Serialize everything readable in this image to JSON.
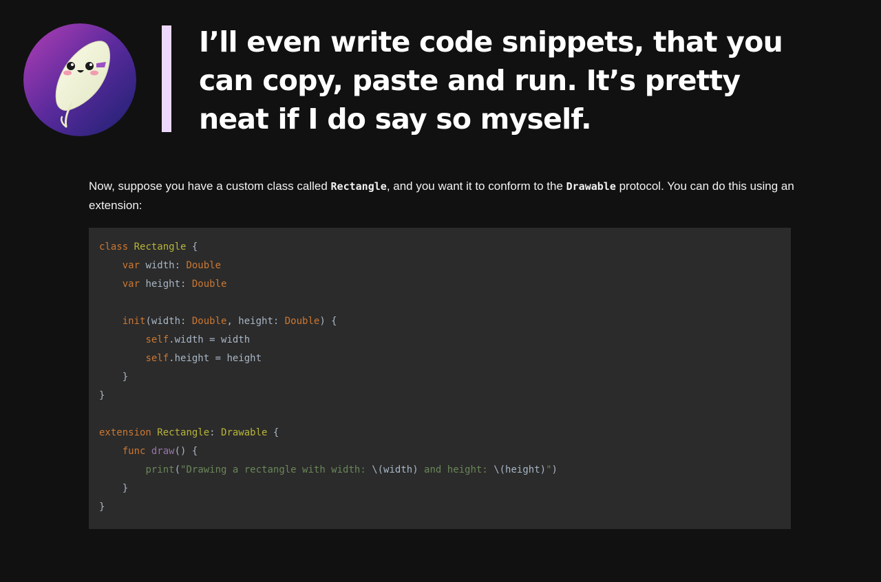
{
  "colors": {
    "background": "#111111",
    "quote_accent": "#ecd7ff",
    "code_background": "#2b2b2b",
    "keyword": "#cc7832",
    "type_name": "#b8b53a",
    "function_name": "#9876aa",
    "string": "#6a8759",
    "identifier": "#a9b7c6"
  },
  "avatar": {
    "icon": "feather-mascot-icon"
  },
  "headline": {
    "lines": [
      "I’ll even write code snippets, that you",
      "can copy, paste and run. It’s pretty",
      "neat if I do say so myself."
    ]
  },
  "intro": {
    "part1": "Now, suppose you have a custom class called ",
    "code1": "Rectangle",
    "part2": ", and you want it to conform to the ",
    "code2": "Drawable",
    "part3": " protocol. You can do this using an extension:"
  },
  "code": {
    "language": "swift",
    "lines": [
      [
        {
          "t": "kw",
          "v": "class"
        },
        {
          "t": "id",
          "v": " "
        },
        {
          "t": "cls",
          "v": "Rectangle"
        },
        {
          "t": "id",
          "v": " {"
        }
      ],
      [
        {
          "t": "id",
          "v": "    "
        },
        {
          "t": "kw",
          "v": "var"
        },
        {
          "t": "id",
          "v": " width: "
        },
        {
          "t": "kw",
          "v": "Double"
        }
      ],
      [
        {
          "t": "id",
          "v": "    "
        },
        {
          "t": "kw",
          "v": "var"
        },
        {
          "t": "id",
          "v": " height: "
        },
        {
          "t": "kw",
          "v": "Double"
        }
      ],
      [],
      [
        {
          "t": "id",
          "v": "    "
        },
        {
          "t": "kw",
          "v": "init"
        },
        {
          "t": "id",
          "v": "(width: "
        },
        {
          "t": "kw",
          "v": "Double"
        },
        {
          "t": "id",
          "v": ", height: "
        },
        {
          "t": "kw",
          "v": "Double"
        },
        {
          "t": "id",
          "v": ") {"
        }
      ],
      [
        {
          "t": "id",
          "v": "        "
        },
        {
          "t": "kw",
          "v": "self"
        },
        {
          "t": "id",
          "v": ".width = width"
        }
      ],
      [
        {
          "t": "id",
          "v": "        "
        },
        {
          "t": "kw",
          "v": "self"
        },
        {
          "t": "id",
          "v": ".height = height"
        }
      ],
      [
        {
          "t": "id",
          "v": "    }"
        }
      ],
      [
        {
          "t": "id",
          "v": "}"
        }
      ],
      [],
      [
        {
          "t": "kw",
          "v": "extension"
        },
        {
          "t": "id",
          "v": " "
        },
        {
          "t": "cls",
          "v": "Rectangle"
        },
        {
          "t": "id",
          "v": ": "
        },
        {
          "t": "cls",
          "v": "Drawable"
        },
        {
          "t": "id",
          "v": " {"
        }
      ],
      [
        {
          "t": "id",
          "v": "    "
        },
        {
          "t": "kw",
          "v": "func"
        },
        {
          "t": "id",
          "v": " "
        },
        {
          "t": "fn",
          "v": "draw"
        },
        {
          "t": "id",
          "v": "() {"
        }
      ],
      [
        {
          "t": "id",
          "v": "        "
        },
        {
          "t": "str",
          "v": "print"
        },
        {
          "t": "id",
          "v": "("
        },
        {
          "t": "str",
          "v": "\"Drawing a rectangle with width: "
        },
        {
          "t": "id",
          "v": "\\(width)"
        },
        {
          "t": "str",
          "v": " and height: "
        },
        {
          "t": "id",
          "v": "\\(height)"
        },
        {
          "t": "str",
          "v": "\""
        },
        {
          "t": "id",
          "v": ")"
        }
      ],
      [
        {
          "t": "id",
          "v": "    }"
        }
      ],
      [
        {
          "t": "id",
          "v": "}"
        }
      ]
    ]
  }
}
